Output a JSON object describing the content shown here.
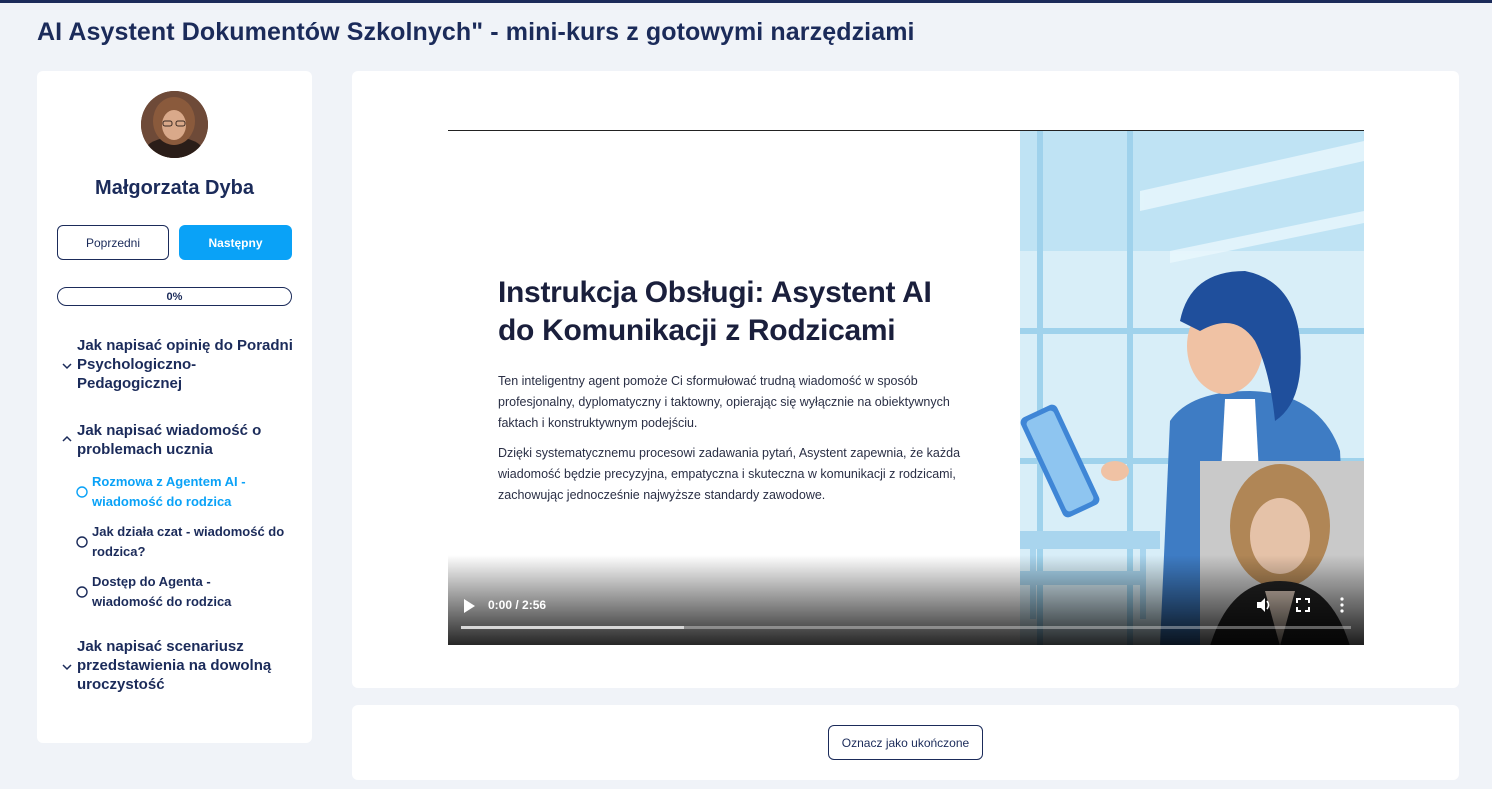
{
  "page": {
    "title": "AI Asystent Dokumentów Szkolnych\" - mini-kurs z gotowymi narzędziami"
  },
  "sidebar": {
    "instructor_name": "Małgorzata Dyba",
    "prev_label": "Poprzedni",
    "next_label": "Następny",
    "progress_text": "0%",
    "progress_value": 0,
    "sections": [
      {
        "title_lines": [
          "Jak napisać opinię do Poradni",
          "Psychologiczno-",
          "Pedagogicznej"
        ],
        "expanded": false,
        "lessons": []
      },
      {
        "title_lines": [
          "Jak napisać wiadomość o",
          "problemach ucznia"
        ],
        "expanded": true,
        "lessons": [
          {
            "lines": [
              "Rozmowa z Agentem AI -",
              "wiadomość do rodzica"
            ],
            "active": true
          },
          {
            "lines": [
              "Jak działa czat - wiadomość do",
              "rodzica?"
            ],
            "active": false
          },
          {
            "lines": [
              "Dostęp do Agenta -",
              "wiadomość do rodzica"
            ],
            "active": false
          }
        ]
      },
      {
        "title_lines": [
          "Jak napisać scenariusz",
          "przedstawienia na dowolną",
          "uroczystość"
        ],
        "expanded": false,
        "lessons": []
      }
    ]
  },
  "video": {
    "slide_title_lines": [
      "Instrukcja Obsługi: Asystent AI",
      "do Komunikacji z Rodzicami"
    ],
    "paragraph1_lines": [
      "Ten inteligentny agent pomoże Ci sformułować trudną wiadomość w sposób",
      "profesjonalny, dyplomatyczny i taktowny, opierając się wyłącznie na obiektywnych",
      "faktach i konstruktywnym podejściu."
    ],
    "paragraph2_lines": [
      "Dzięki systematycznemu procesowi zadawania pytań, Asystent zapewnia, że każda",
      "wiadomość będzie precyzyjna, empatyczna i skuteczna w komunikacji z rodzicami,",
      "zachowując jednocześnie najwyższe standardy zawodowe."
    ],
    "time_display": "0:00 / 2:56",
    "buffered_fraction": 0.25,
    "icons": [
      "play-icon",
      "volume-icon",
      "fullscreen-icon",
      "more-options-icon"
    ]
  },
  "actions": {
    "mark_complete_label": "Oznacz jako ukończone"
  },
  "colors": {
    "navy": "#1b2b5a",
    "accent": "#0aa2f7",
    "background": "#f0f3f8"
  }
}
